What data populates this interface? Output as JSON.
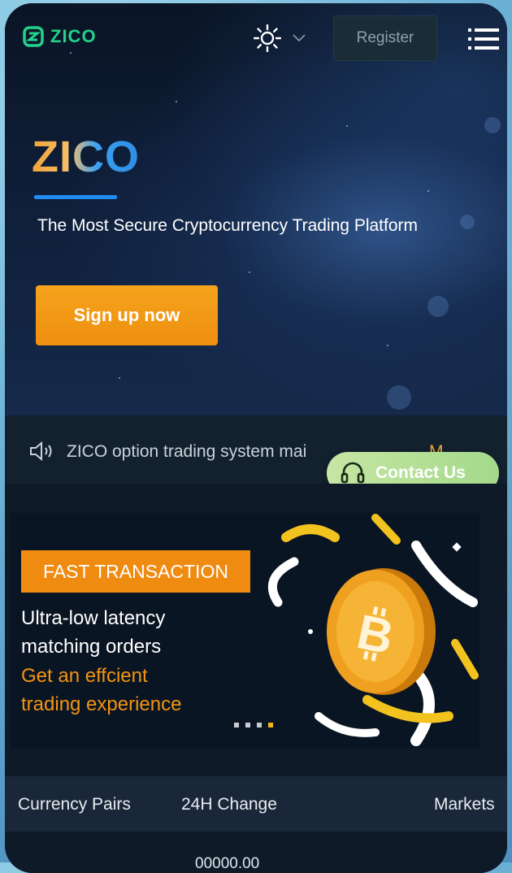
{
  "brand": {
    "name": "ZICO"
  },
  "nav": {
    "register_label": "Register"
  },
  "hero": {
    "title": "ZICO",
    "subtitle": "The Most Secure Cryptocurrency Trading Platform",
    "cta_label": "Sign up now"
  },
  "notice": {
    "text": "ZICO option trading system mai",
    "more": "M"
  },
  "contact": {
    "label": "Contact Us"
  },
  "banner": {
    "tag": "FAST TRANSACTION",
    "line1": "Ultra-low latency",
    "line2": "matching orders",
    "line3": "Get an effcient",
    "line4": "trading experience"
  },
  "table": {
    "headers": [
      "Currency Pairs",
      "24H Change",
      "Markets"
    ],
    "first_row_value": "00000.00"
  },
  "colors": {
    "accent_orange": "#f08b12",
    "brand_green": "#22d28a",
    "accent_blue": "#1e8cf0",
    "contact_green": "#a3d98c"
  },
  "icons": [
    "zico-logo-icon",
    "sun-icon",
    "chevron-down-icon",
    "menu-icon",
    "speaker-icon",
    "headset-icon",
    "bitcoin-icon"
  ]
}
